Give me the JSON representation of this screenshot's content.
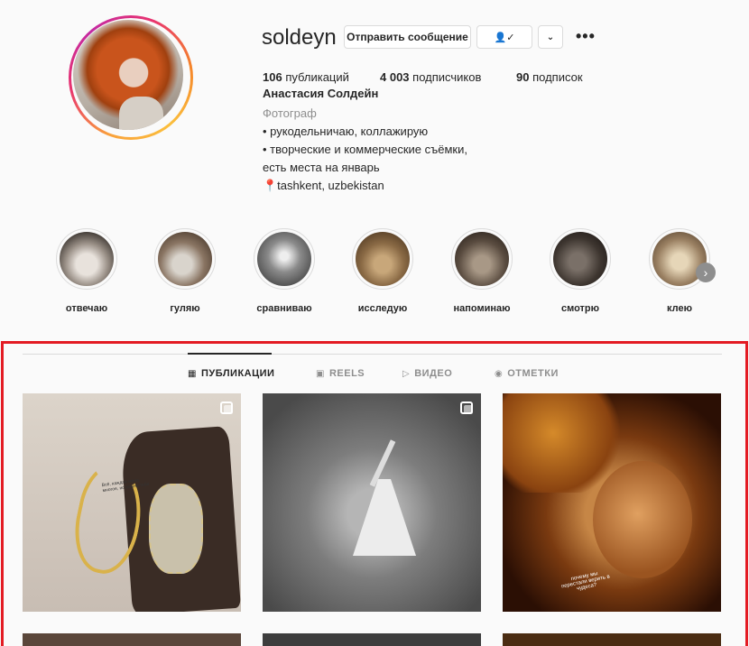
{
  "profile": {
    "username": "soldeyn",
    "message_button": "Отправить сообщение",
    "follow_icon": "person-check-icon",
    "more_icon": "chevron-down-icon",
    "options_icon": "more-options-icon",
    "stats": {
      "posts_count": "106",
      "posts_label": "публикаций",
      "followers_count": "4 003",
      "followers_label": "подписчиков",
      "following_count": "90",
      "following_label": "подписок"
    },
    "full_name": "Анастасия Солдейн",
    "category": "Фотограф",
    "bio_line1": "• рукодельничаю, коллажирую",
    "bio_line2": "• творческие и коммерческие съёмки,",
    "bio_line3": "есть места на январь",
    "bio_line4": "📍tashkent, uzbekistan"
  },
  "highlights": [
    {
      "label": "отвечаю"
    },
    {
      "label": "гуляю"
    },
    {
      "label": "сравниваю"
    },
    {
      "label": "исследую"
    },
    {
      "label": "напоминаю"
    },
    {
      "label": "смотрю"
    },
    {
      "label": "клею"
    }
  ],
  "tabs": {
    "posts": "ПУБЛИКАЦИИ",
    "reels": "REELS",
    "video": "ВИДЕО",
    "tagged": "ОТМЕТКИ"
  },
  "posts": {
    "post1_text": "Всё, каждая мена многое, но важно тебя",
    "post3_text": "почему мы перестали верить в чудеса?"
  },
  "colors": {
    "selection_border": "#e31b23",
    "text_primary": "#262626",
    "text_secondary": "#8e8e8e"
  }
}
